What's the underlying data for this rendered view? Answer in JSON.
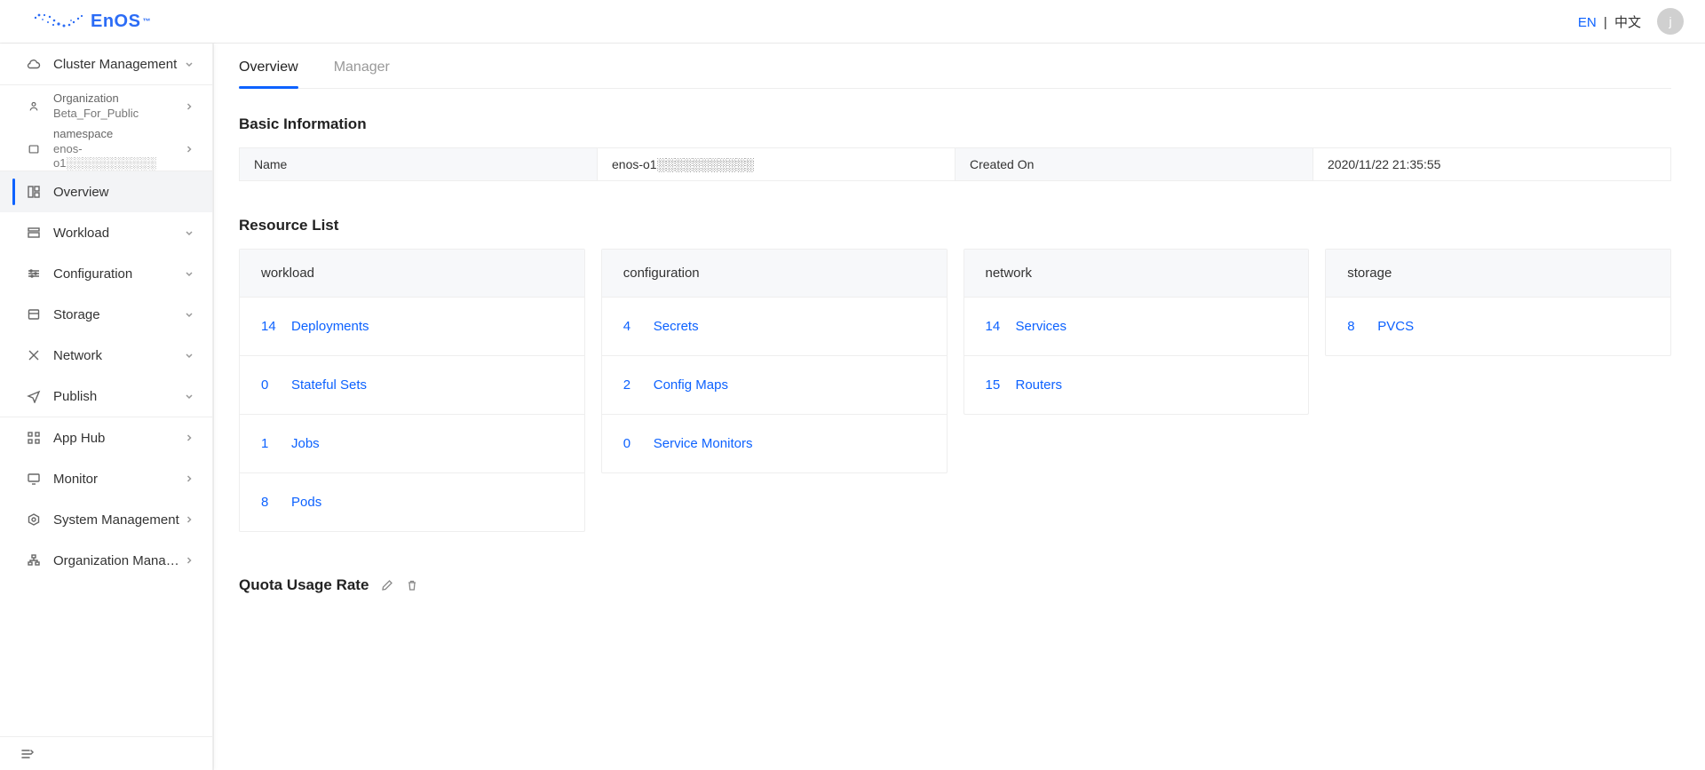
{
  "brand": {
    "name": "EnOS",
    "tm": "™"
  },
  "lang": {
    "en": "EN",
    "sep": "|",
    "cn": "中文"
  },
  "avatar": "j",
  "sidebar": {
    "main": "Cluster Management",
    "org_label": "Organization",
    "org_value": "Beta_For_Public",
    "ns_label": "namespace",
    "ns_value": "enos-o1░░░░░░░░░░░",
    "items": [
      {
        "label": "Overview"
      },
      {
        "label": "Workload"
      },
      {
        "label": "Configuration"
      },
      {
        "label": "Storage"
      },
      {
        "label": "Network"
      },
      {
        "label": "Publish"
      }
    ],
    "items2": [
      {
        "label": "App Hub"
      },
      {
        "label": "Monitor"
      },
      {
        "label": "System Management"
      },
      {
        "label": "Organization Manage..."
      }
    ]
  },
  "tabs": {
    "overview": "Overview",
    "manager": "Manager"
  },
  "basic": {
    "title": "Basic Information",
    "name_label": "Name",
    "name_value": "enos-o1░░░░░░░░░░░",
    "created_label": "Created On",
    "created_value": "2020/11/22 21:35:55"
  },
  "resources": {
    "title": "Resource List",
    "cards": [
      {
        "head": "workload",
        "rows": [
          {
            "count": "14",
            "name": "Deployments"
          },
          {
            "count": "0",
            "name": "Stateful Sets"
          },
          {
            "count": "1",
            "name": "Jobs"
          },
          {
            "count": "8",
            "name": "Pods"
          }
        ]
      },
      {
        "head": "configuration",
        "rows": [
          {
            "count": "4",
            "name": "Secrets"
          },
          {
            "count": "2",
            "name": "Config Maps"
          },
          {
            "count": "0",
            "name": "Service Monitors"
          }
        ]
      },
      {
        "head": "network",
        "rows": [
          {
            "count": "14",
            "name": "Services"
          },
          {
            "count": "15",
            "name": "Routers"
          }
        ]
      },
      {
        "head": "storage",
        "rows": [
          {
            "count": "8",
            "name": "PVCS"
          }
        ]
      }
    ]
  },
  "quota": {
    "title": "Quota Usage Rate"
  }
}
